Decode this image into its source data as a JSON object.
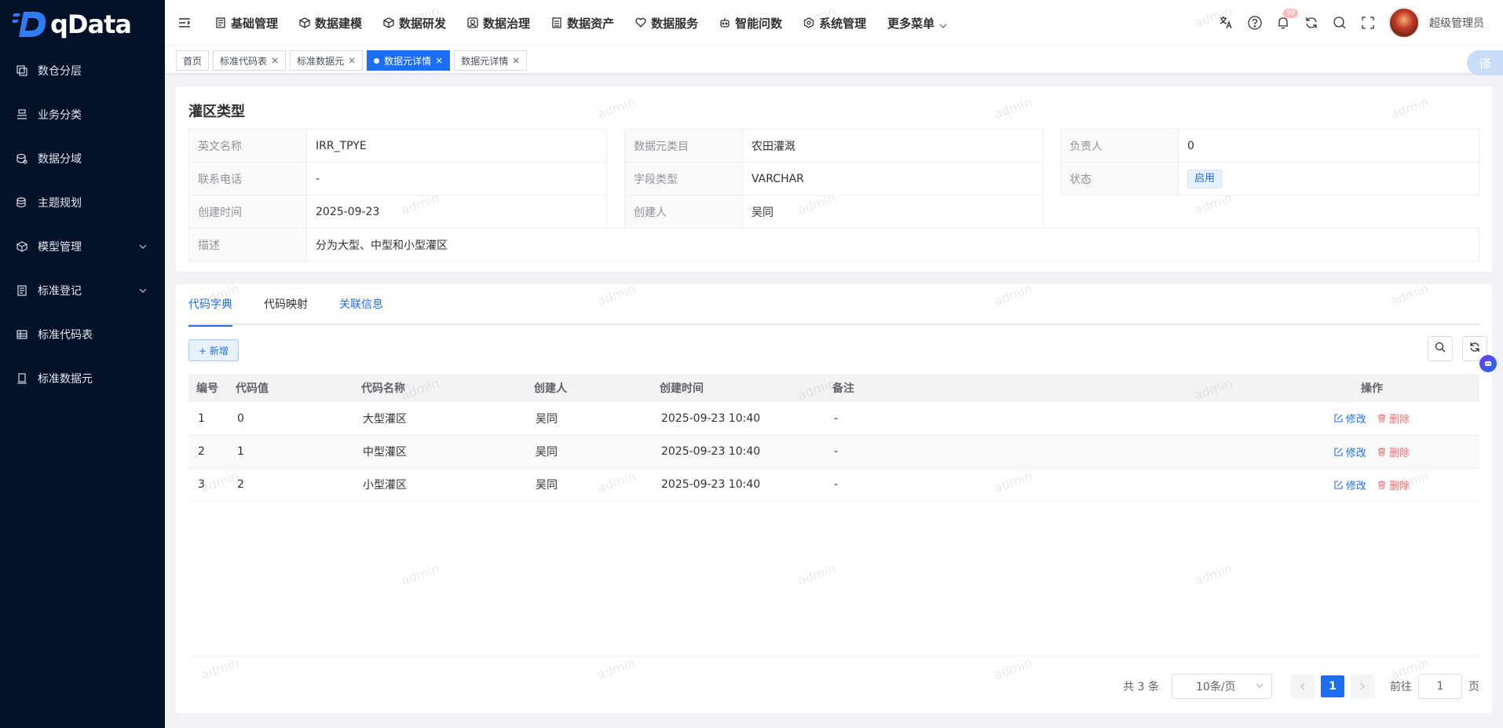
{
  "brand": {
    "name": "qData"
  },
  "sidebar": {
    "items": [
      {
        "label": "数仓分层",
        "icon": "layers-icon"
      },
      {
        "label": "业务分类",
        "icon": "category-icon"
      },
      {
        "label": "数据分域",
        "icon": "domain-icon"
      },
      {
        "label": "主题规划",
        "icon": "topic-icon"
      },
      {
        "label": "模型管理",
        "icon": "model-icon",
        "expandable": true
      },
      {
        "label": "标准登记",
        "icon": "register-icon",
        "expandable": true
      },
      {
        "label": "标准代码表",
        "icon": "table-icon"
      },
      {
        "label": "标准数据元",
        "icon": "data-element-icon"
      }
    ]
  },
  "header": {
    "nav": [
      {
        "label": "基础管理",
        "icon": "doc-icon"
      },
      {
        "label": "数据建模",
        "icon": "cube-icon"
      },
      {
        "label": "数据研发",
        "icon": "cube-icon"
      },
      {
        "label": "数据治理",
        "icon": "govern-icon"
      },
      {
        "label": "数据资产",
        "icon": "asset-icon"
      },
      {
        "label": "数据服务",
        "icon": "service-icon"
      },
      {
        "label": "智能问数",
        "icon": "robot-icon"
      },
      {
        "label": "系统管理",
        "icon": "settings-icon"
      },
      {
        "label": "更多菜单",
        "icon": "",
        "dropdown": true
      }
    ],
    "notifications": "99",
    "username": "超级管理员"
  },
  "tags": [
    {
      "label": "首页",
      "closable": false,
      "active": false
    },
    {
      "label": "标准代码表",
      "closable": true,
      "active": false
    },
    {
      "label": "标准数据元",
      "closable": true,
      "active": false
    },
    {
      "label": "数据元详情",
      "closable": true,
      "active": true
    },
    {
      "label": "数据元详情",
      "closable": true,
      "active": false
    }
  ],
  "translate_label": "译",
  "detail": {
    "title": "灌区类型",
    "fields": {
      "en_name_label": "英文名称",
      "en_name": "IRR_TPYE",
      "category_label": "数据元类目",
      "category": "农田灌溉",
      "owner_label": "负责人",
      "owner": "0",
      "phone_label": "联系电话",
      "phone": "-",
      "field_type_label": "字段类型",
      "field_type": "VARCHAR",
      "status_label": "状态",
      "status": "启用",
      "created_label": "创建时间",
      "created": "2025-09-23",
      "creator_label": "创建人",
      "creator": "吴同",
      "desc_label": "描述",
      "desc": "分为大型、中型和小型灌区"
    }
  },
  "tabs": [
    {
      "label": "代码字典",
      "state": "active"
    },
    {
      "label": "代码映射",
      "state": "normal"
    },
    {
      "label": "关联信息",
      "state": "link"
    }
  ],
  "toolbar": {
    "add_label": "+ 新增"
  },
  "table": {
    "headers": [
      "编号",
      "代码值",
      "代码名称",
      "创建人",
      "创建时间",
      "备注",
      "操作"
    ],
    "rows": [
      [
        "1",
        "0",
        "大型灌区",
        "吴同",
        "2025-09-23 10:40",
        "-"
      ],
      [
        "2",
        "1",
        "中型灌区",
        "吴同",
        "2025-09-23 10:40",
        "-"
      ],
      [
        "3",
        "2",
        "小型灌区",
        "吴同",
        "2025-09-23 10:40",
        "-"
      ]
    ],
    "edit_label": "修改",
    "delete_label": "删除"
  },
  "pagination": {
    "total": "共 3 条",
    "page_size": "10条/页",
    "current": "1",
    "goto_label": "前往",
    "goto_value": "1",
    "page_unit": "页"
  },
  "watermark": "admin"
}
